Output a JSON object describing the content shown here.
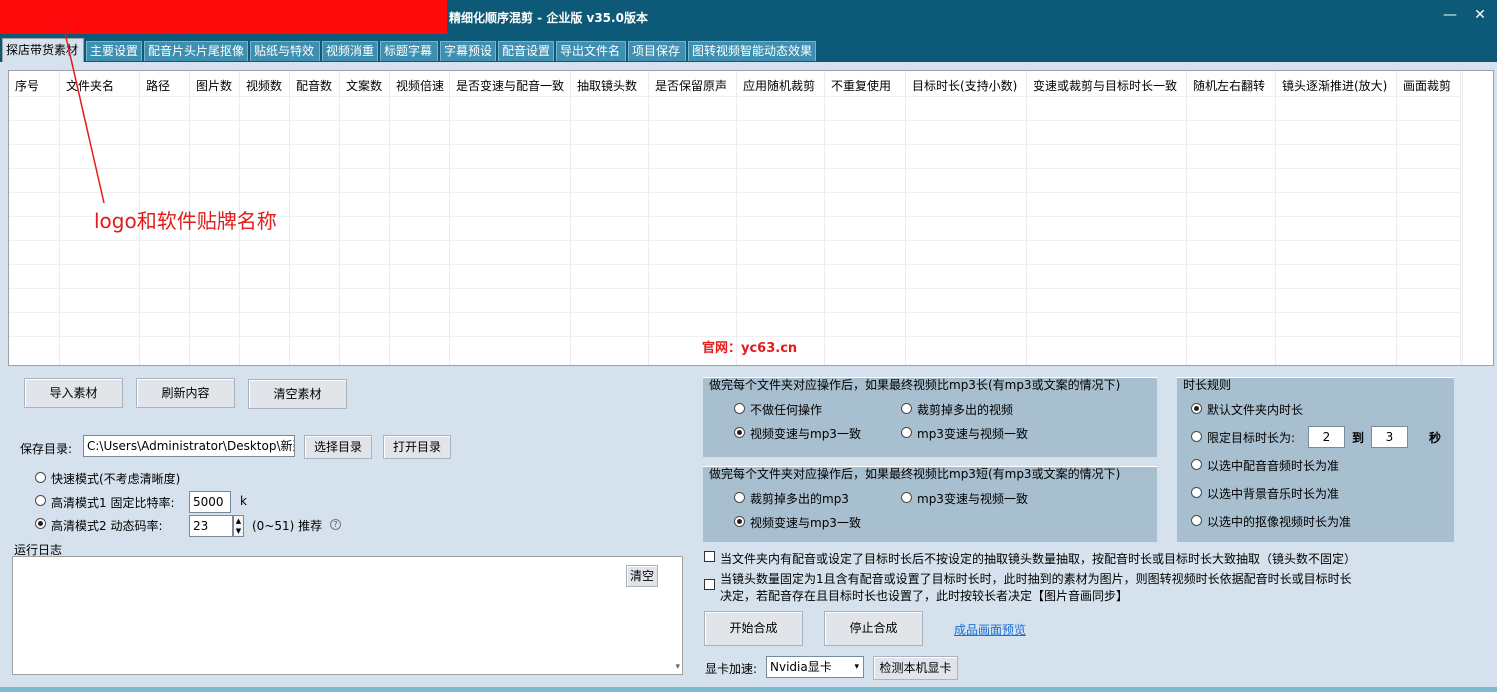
{
  "window": {
    "title": "精细化顺序混剪 - 企业版  v35.0版本",
    "minimize": "—",
    "close": "✕"
  },
  "tabs": [
    {
      "label": "探店带货素材",
      "active": true
    },
    {
      "label": "主要设置"
    },
    {
      "label": "配音片头片尾抠像"
    },
    {
      "label": "贴纸与特效"
    },
    {
      "label": "视频消重"
    },
    {
      "label": "标题字幕"
    },
    {
      "label": "字幕预设"
    },
    {
      "label": "配音设置"
    },
    {
      "label": "导出文件名"
    },
    {
      "label": "项目保存"
    },
    {
      "label": "图转视频智能动态效果"
    }
  ],
  "grid": {
    "columns": [
      "序号",
      "文件夹名",
      "路径",
      "图片数",
      "视频数",
      "配音数",
      "文案数",
      "视频倍速",
      "是否变速与配音一致",
      "抽取镜头数",
      "是否保留原声",
      "应用随机裁剪",
      "不重复使用",
      "目标时长(支持小数)",
      "变速或裁剪与目标时长一致",
      "随机左右翻转",
      "镜头逐渐推进(放大)",
      "画面裁剪"
    ]
  },
  "annotation": {
    "logo_note": "logo和软件贴牌名称",
    "website": "官网：yc63.cn"
  },
  "actions": {
    "import": "导入素材",
    "refresh": "刷新内容",
    "clear": "清空素材"
  },
  "save": {
    "label": "保存目录:",
    "path": "C:\\Users\\Administrator\\Desktop\\新建",
    "choose": "选择目录",
    "open": "打开目录"
  },
  "quality": {
    "fast": "快速模式(不考虑清晰度)",
    "hq1": "高清模式1 固定比特率:",
    "hq1_value": "5000",
    "hq1_unit": "k",
    "hq2": "高清模式2 动态码率:",
    "hq2_value": "23",
    "hq2_range": "(0~51)  推荐",
    "help": "?"
  },
  "log": {
    "label": "运行日志",
    "clear": "清空"
  },
  "longer_group": {
    "title": "做完每个文件夹对应操作后，如果最终视频比mp3长(有mp3或文案的情况下)",
    "opt1": "不做任何操作",
    "opt2": "裁剪掉多出的视频",
    "opt3": "视频变速与mp3一致",
    "opt4": "mp3变速与视频一致"
  },
  "shorter_group": {
    "title": "做完每个文件夹对应操作后，如果最终视频比mp3短(有mp3或文案的情况下)",
    "opt1": "裁剪掉多出的mp3",
    "opt2": "mp3变速与视频一致",
    "opt3": "视频变速与mp3一致"
  },
  "duration_rule": {
    "title": "时长规则",
    "opt1": "默认文件夹内时长",
    "opt2": "限定目标时长为:",
    "from": "2",
    "to_label": "到",
    "to": "3",
    "unit": "秒",
    "opt3": "以选中配音音频时长为准",
    "opt4": "以选中背景音乐时长为准",
    "opt5": "以选中的抠像视频时长为准"
  },
  "checks": {
    "c1": "当文件夹内有配音或设定了目标时长后不按设定的抽取镜头数量抽取，按配音时长或目标时长大致抽取（镜头数不固定）",
    "c2a": "当镜头数量固定为1且含有配音或设置了目标时长时，此时抽到的素材为图片，则图转视频时长依据配音时长或目标时长",
    "c2b": "决定，若配音存在且目标时长也设置了，此时按较长者决定【图片音画同步】"
  },
  "run": {
    "start": "开始合成",
    "stop": "停止合成",
    "preview": "成品画面预览"
  },
  "gpu": {
    "label": "显卡加速:",
    "value": "Nvidia显卡",
    "detect": "检测本机显卡"
  },
  "colors": {
    "titlebar": "#0d5a78",
    "annotation_red": "#e21b1b"
  }
}
